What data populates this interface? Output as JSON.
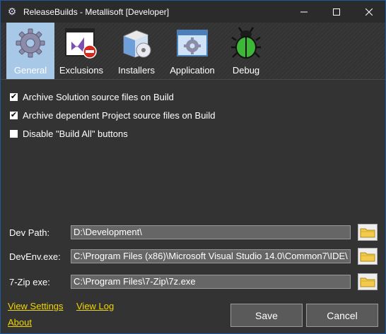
{
  "window": {
    "title": "ReleaseBuilds - Metallisoft [Developer]",
    "icon": "gear-icon",
    "controls": [
      "minimize-icon",
      "maximize-icon",
      "close-icon"
    ]
  },
  "toolbar": {
    "items": [
      {
        "label": "General",
        "icon": "gear-icon",
        "selected": true
      },
      {
        "label": "Exclusions",
        "icon": "visual-studio-exclude-icon",
        "selected": false
      },
      {
        "label": "Installers",
        "icon": "installer-icon",
        "selected": false
      },
      {
        "label": "Application",
        "icon": "application-window-icon",
        "selected": false
      },
      {
        "label": "Debug",
        "icon": "bug-icon",
        "selected": false
      }
    ]
  },
  "general": {
    "checkboxes": [
      {
        "label": "Archive Solution source files on Build",
        "checked": true
      },
      {
        "label": "Archive dependent Project source files on Build",
        "checked": true
      },
      {
        "label": "Disable \"Build All\" buttons",
        "checked": false
      }
    ],
    "paths": [
      {
        "label": "Dev Path:",
        "value": "D:\\Development\\"
      },
      {
        "label": "DevEnv.exe:",
        "value": "C:\\Program Files (x86)\\Microsoft Visual Studio 14.0\\Common7\\IDE\\"
      },
      {
        "label": "7-Zip exe:",
        "value": "C:\\Program Files\\7-Zip\\7z.exe"
      }
    ]
  },
  "footer": {
    "view_settings": "View Settings",
    "view_log": "View Log",
    "about": "About",
    "save": "Save",
    "cancel": "Cancel"
  },
  "colors": {
    "link": "#f2d600",
    "selected_tab": "#a8c8e8",
    "background": "#333333"
  }
}
